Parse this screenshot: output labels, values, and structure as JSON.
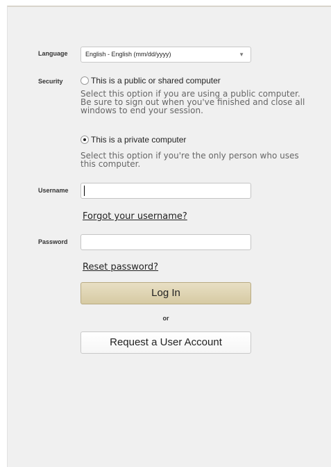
{
  "form": {
    "language": {
      "label": "Language",
      "selected": "English - English (mm/dd/yyyy)"
    },
    "security": {
      "label": "Security",
      "public_option": "This is a public or shared computer",
      "public_description": "Select this option if you are using a public computer. Be sure to sign out when you've finished and close all windows to end your session.",
      "private_option": "This is a private computer",
      "private_description": "Select this option if you're the only person who uses this computer.",
      "selected": "private"
    },
    "username": {
      "label": "Username",
      "value": "",
      "forgot_link": "Forgot your username?"
    },
    "password": {
      "label": "Password",
      "value": "",
      "reset_link": "Reset password?"
    },
    "login_button": "Log In",
    "or_text": "or",
    "request_button": "Request a User Account"
  },
  "icons": {
    "select_arrow": "chevron-down-icon"
  },
  "colors": {
    "login_button": "#d9cda8",
    "panel_background": "#f0f0f0"
  }
}
